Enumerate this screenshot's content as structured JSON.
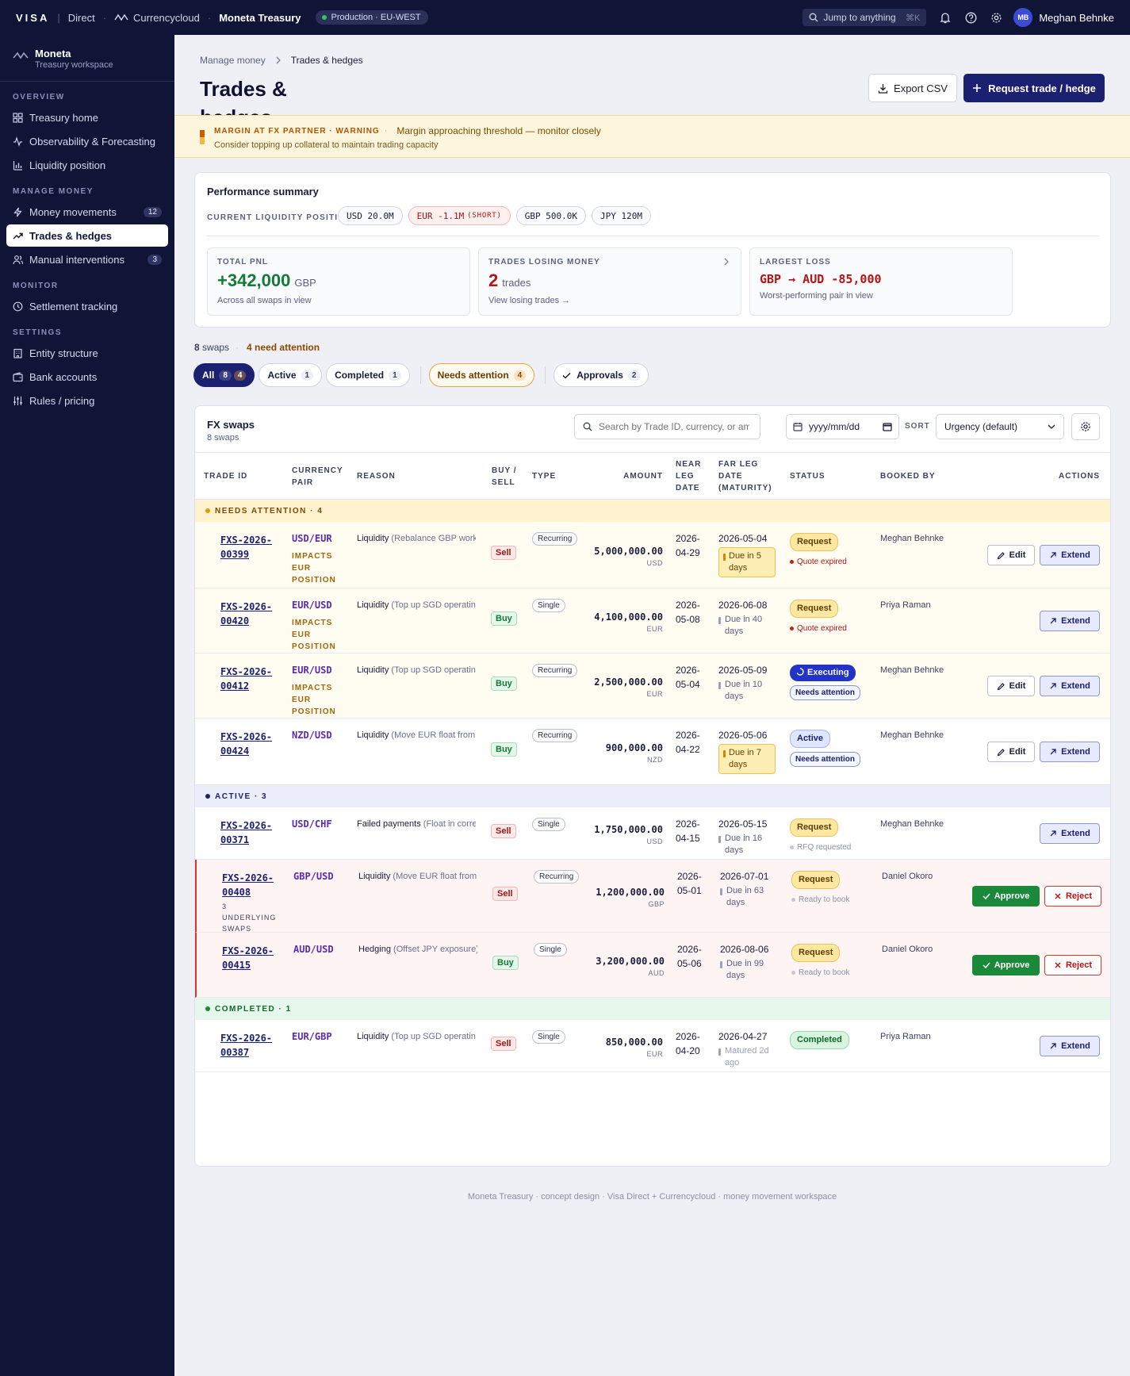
{
  "topbar": {
    "brand": "VISA",
    "direct": "Direct",
    "currencycloud": "Currencycloud",
    "product": "Moneta Treasury",
    "env": "Production · EU-WEST",
    "search_placeholder": "Jump to anything",
    "shortcut": "⌘K",
    "user_initials": "MB",
    "user_name": "Meghan Behnke"
  },
  "workspace": {
    "name": "Moneta",
    "sub": "Treasury workspace"
  },
  "nav": {
    "overview": "OVERVIEW",
    "manage": "MANAGE MONEY",
    "monitor": "MONITOR",
    "settings": "SETTINGS",
    "treasury_home": "Treasury home",
    "observability": "Observability & Forecasting",
    "liquidity": "Liquidity position",
    "money_movements": "Money movements",
    "money_movements_count": "12",
    "trades": "Trades & hedges",
    "manual": "Manual interventions",
    "manual_count": "3",
    "settlement": "Settlement tracking",
    "entity": "Entity structure",
    "bank": "Bank accounts",
    "rules": "Rules / pricing"
  },
  "breadcrumb": {
    "parent": "Manage money",
    "current": "Trades & hedges"
  },
  "page": {
    "title": "Trades & hedges",
    "export_label": "Export CSV",
    "request_label": "Request trade / hedge"
  },
  "banner": {
    "tag": "MARGIN AT FX PARTNER · WARNING",
    "message": "Margin approaching threshold — monitor closely",
    "detail": "Consider topping up collateral to maintain trading capacity"
  },
  "perf": {
    "title": "Performance summary",
    "liq_label": "CURRENT LIQUIDITY POSITION",
    "chips": {
      "usd": "USD 20.0M",
      "eur": "EUR -1.1M",
      "eur_note": "(SHORT)",
      "gbp": "GBP 500.0K",
      "jpy": "JPY 120M"
    },
    "pnl_label": "TOTAL PNL",
    "pnl_value": "+342,000",
    "pnl_unit": "GBP",
    "pnl_note": "Across all swaps in view",
    "losing_label": "TRADES LOSING MONEY",
    "losing_value": "2",
    "losing_unit": "trades",
    "losing_note": "View losing trades →",
    "loss_label": "LARGEST LOSS",
    "loss_value": "GBP → AUD -85,000",
    "loss_note": "Worst-performing pair in view"
  },
  "summary": {
    "count": "8",
    "count_label": "swaps",
    "attention": "4 need attention"
  },
  "filters": {
    "all": "All",
    "all_n": "8",
    "all_n2": "4",
    "active": "Active",
    "active_n": "1",
    "completed": "Completed",
    "completed_n": "1",
    "needs": "Needs attention",
    "needs_n": "4",
    "approvals": "Approvals",
    "approvals_n": "2"
  },
  "table": {
    "title": "FX swaps",
    "subtitle": "8 swaps",
    "search_placeholder": "Search by Trade ID, currency, or amount",
    "date_placeholder": "yyyy/mm/dd",
    "sort_label": "SORT",
    "sort_value": "Urgency (default)",
    "headers": {
      "trade_id": "TRADE ID",
      "pair": "CURRENCY PAIR",
      "reason": "REASON",
      "buysell": "BUY / SELL",
      "type": "TYPE",
      "amount": "AMOUNT",
      "near": "NEAR LEG DATE",
      "far": "FAR LEG DATE (MATURITY)",
      "status": "STATUS",
      "booked": "BOOKED BY",
      "actions": "ACTIONS"
    },
    "groups": {
      "attention": "NEEDS ATTENTION · 4",
      "active": "ACTIVE · 3",
      "completed": "COMPLETED · 1"
    },
    "labels": {
      "edit": "Edit",
      "extend": "Extend",
      "approve": "Approve",
      "reject": "Reject"
    },
    "rows": [
      {
        "id": "FXS-2026-00399",
        "pair": "USD/EUR",
        "impact": "IMPACTS EUR POSITION",
        "reason": "Liquidity",
        "reason_detail": "(Rebalance GBP working capital)",
        "side": "Sell",
        "type": "Recurring",
        "amount": "5,000,000.00",
        "ccy": "USD",
        "near": "2026-04-29",
        "far": "2026-05-04",
        "due": "Due in 5 days",
        "status": "Request",
        "sub": "Quote expired",
        "booked": "Meghan Behnke"
      },
      {
        "id": "FXS-2026-00420",
        "pair": "EUR/USD",
        "impact": "IMPACTS EUR POSITION",
        "reason": "Liquidity",
        "reason_detail": "(Top up SGD operating account)",
        "side": "Buy",
        "type": "Single",
        "amount": "4,100,000.00",
        "ccy": "EUR",
        "near": "2026-05-08",
        "far": "2026-06-08",
        "due": "Due in 40 days",
        "status": "Request",
        "sub": "Quote expired",
        "booked": "Priya Raman"
      },
      {
        "id": "FXS-2026-00412",
        "pair": "EUR/USD",
        "impact": "IMPACTS EUR POSITION",
        "reason": "Liquidity",
        "reason_detail": "(Top up SGD operating account)",
        "side": "Buy",
        "type": "Recurring",
        "amount": "2,500,000.00",
        "ccy": "EUR",
        "near": "2026-05-04",
        "far": "2026-05-09",
        "due": "Due in 10 days",
        "status": "Executing",
        "sub": "Needs attention",
        "booked": "Meghan Behnke"
      },
      {
        "id": "FXS-2026-00424",
        "pair": "NZD/USD",
        "reason": "Liquidity",
        "reason_detail": "(Move EUR float from treasury)",
        "side": "Buy",
        "type": "Recurring",
        "amount": "900,000.00",
        "ccy": "NZD",
        "near": "2026-04-22",
        "far": "2026-05-06",
        "due": "Due in 7 days",
        "status": "Active",
        "sub": "Needs attention",
        "booked": "Meghan Behnke"
      },
      {
        "id": "FXS-2026-00371",
        "pair": "USD/CHF",
        "reason": "Failed payments",
        "reason_detail": "(Float in correspondent account)",
        "side": "Sell",
        "type": "Single",
        "amount": "1,750,000.00",
        "ccy": "USD",
        "near": "2026-04-15",
        "far": "2026-05-15",
        "due": "Due in 16 days",
        "status": "Request",
        "sub": "RFQ requested",
        "booked": "Meghan Behnke"
      },
      {
        "id": "FXS-2026-00408",
        "pair": "GBP/USD",
        "underlying": "3 UNDERLYING SWAPS",
        "reason": "Liquidity",
        "reason_detail": "(Move EUR float from treasury)",
        "side": "Sell",
        "type": "Recurring",
        "amount": "1,200,000.00",
        "ccy": "GBP",
        "near": "2026-05-01",
        "far": "2026-07-01",
        "due": "Due in 63 days",
        "status": "Request",
        "sub": "Ready to book",
        "booked": "Daniel Okoro"
      },
      {
        "id": "FXS-2026-00415",
        "pair": "AUD/USD",
        "reason": "Hedging",
        "reason_detail": "(Offset JPY exposure)",
        "side": "Buy",
        "type": "Single",
        "amount": "3,200,000.00",
        "ccy": "AUD",
        "near": "2026-05-06",
        "far": "2026-08-06",
        "due": "Due in 99 days",
        "status": "Request",
        "sub": "Ready to book",
        "booked": "Daniel Okoro"
      },
      {
        "id": "FXS-2026-00387",
        "pair": "EUR/GBP",
        "reason": "Liquidity",
        "reason_detail": "(Top up SGD operating account)",
        "side": "Sell",
        "type": "Single",
        "amount": "850,000.00",
        "ccy": "EUR",
        "near": "2026-04-20",
        "far": "2026-04-27",
        "due": "Matured 2d ago",
        "status": "Completed",
        "booked": "Priya Raman"
      }
    ]
  },
  "footer": "Moneta Treasury · concept design · Visa Direct + Currencycloud · money movement workspace"
}
